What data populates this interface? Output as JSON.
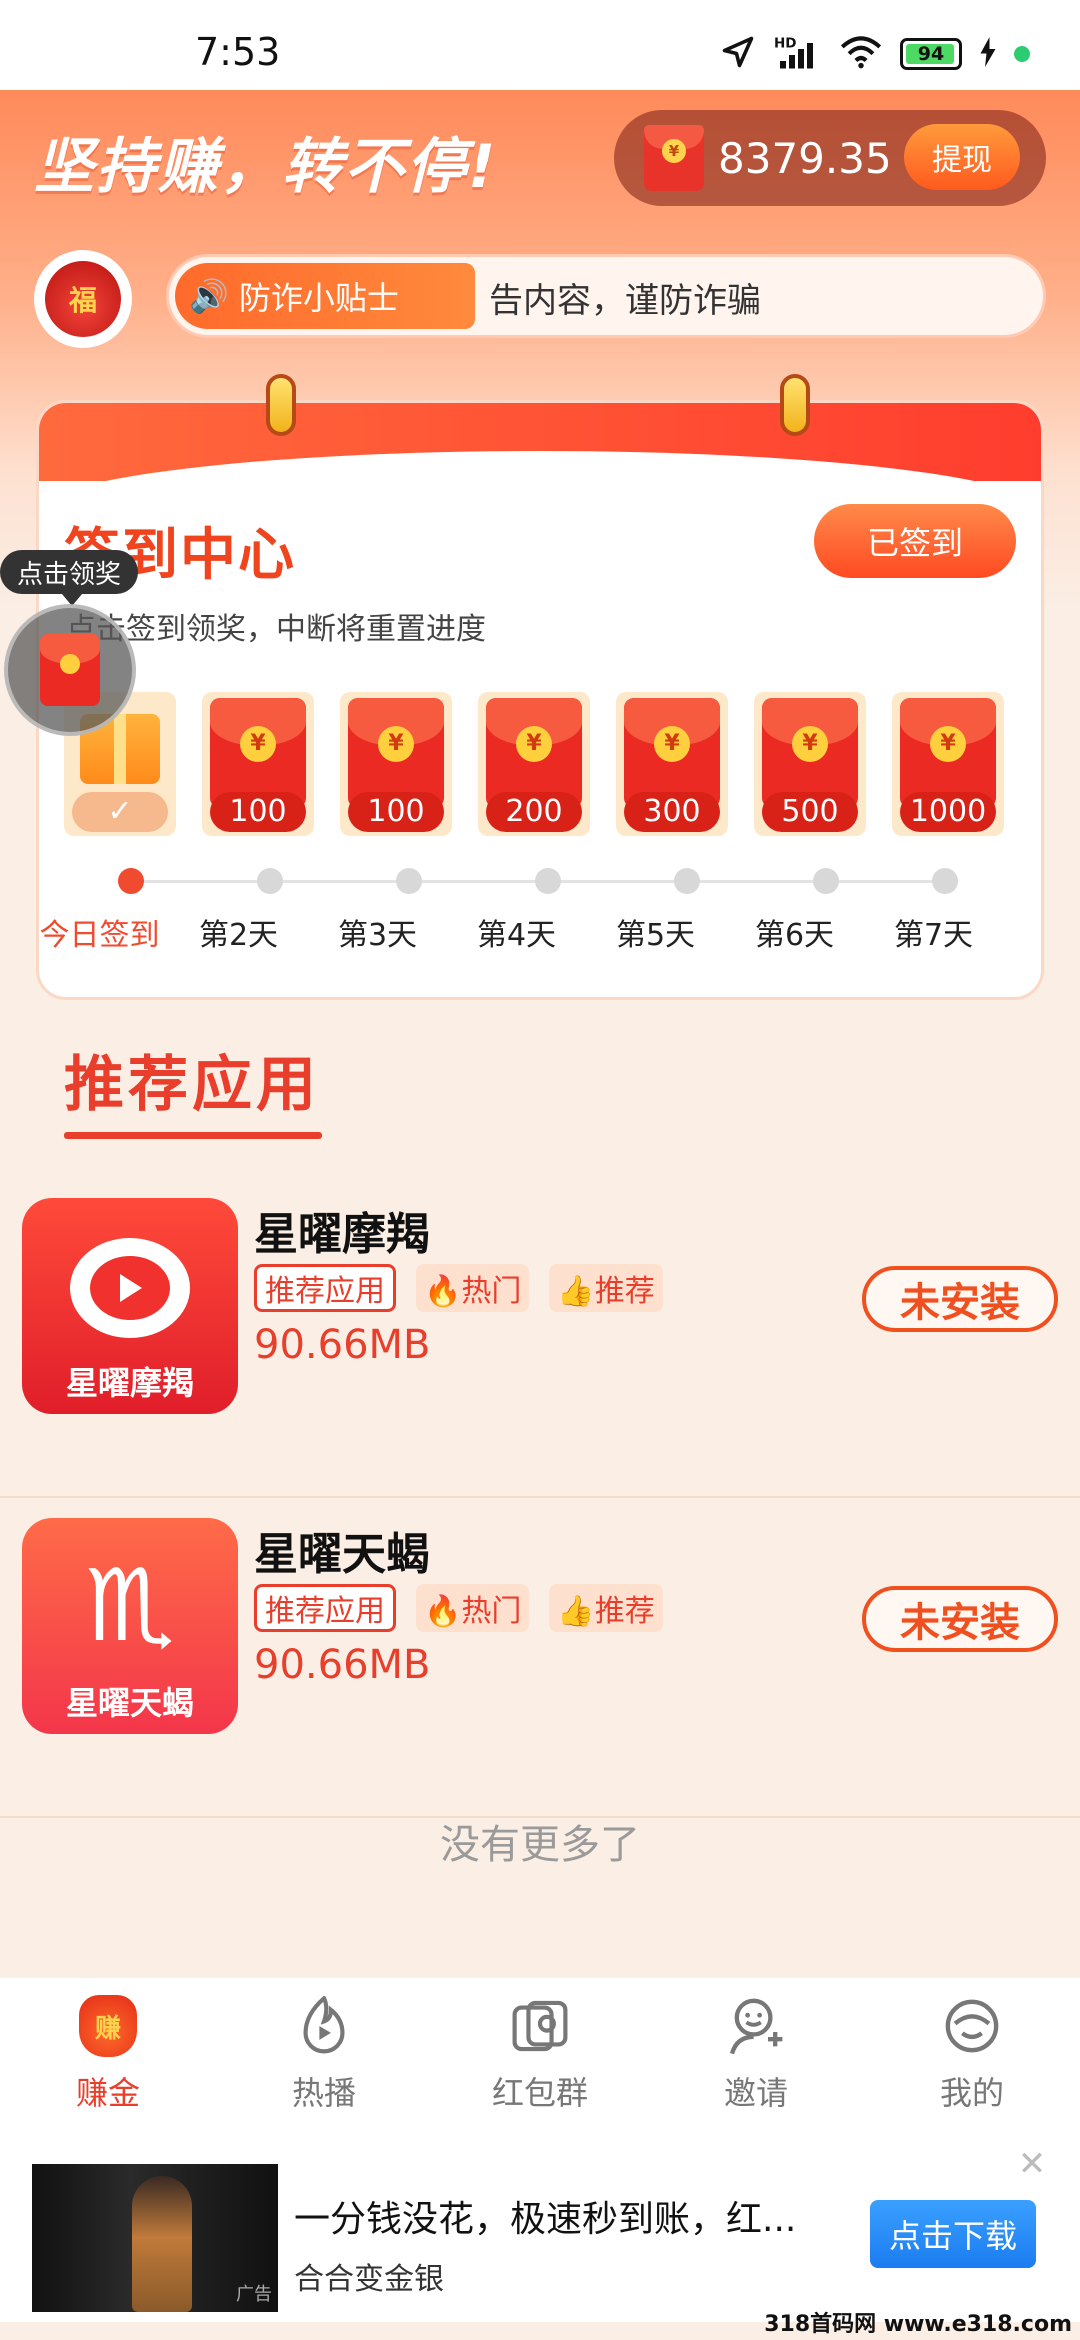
{
  "status_bar": {
    "time": "7:53",
    "network": "HD",
    "battery": "94"
  },
  "header": {
    "slogan": "坚持赚，转不停!",
    "balance": "8379.35",
    "withdraw_label": "提现",
    "fortune_char": "福",
    "notice_tag": "防诈小贴士",
    "notice_text": "告内容，谨防诈骗"
  },
  "signin": {
    "title": "签到中心",
    "signed_label": "已签到",
    "hint": "点击签到领奖，中断将重置进度",
    "rewards": [
      "100",
      "100",
      "200",
      "300",
      "500",
      "1000"
    ],
    "days": [
      "今日签到",
      "第2天",
      "第3天",
      "第4天",
      "第5天",
      "第6天",
      "第7天"
    ],
    "today_check": "✓"
  },
  "floating": {
    "tip": "点击领奖"
  },
  "recommend": {
    "title": "推荐应用",
    "apps": [
      {
        "name": "星曜摩羯",
        "tag_main": "推荐应用",
        "tag_hot": "🔥热门",
        "tag_rec": "👍推荐",
        "size": "90.66MB",
        "button": "未安装",
        "icon_caption": "星曜摩羯"
      },
      {
        "name": "星曜天蝎",
        "tag_main": "推荐应用",
        "tag_hot": "🔥热门",
        "tag_rec": "👍推荐",
        "size": "90.66MB",
        "button": "未安装",
        "icon_caption": "星曜天蝎"
      }
    ],
    "no_more": "没有更多了"
  },
  "bottom_nav": [
    {
      "label": "赚金",
      "icon": "earn-bag-icon",
      "glyph": "赚"
    },
    {
      "label": "热播",
      "icon": "hot-play-icon",
      "glyph": "▶"
    },
    {
      "label": "红包群",
      "icon": "red-packet-group-icon",
      "glyph": "◎"
    },
    {
      "label": "邀请",
      "icon": "invite-icon",
      "glyph": "☺"
    },
    {
      "label": "我的",
      "icon": "profile-icon",
      "glyph": "◡"
    }
  ],
  "ad": {
    "title": "一分钱没花，极速秒到账，红...",
    "subtitle": "合合变金银",
    "button": "点击下载",
    "close": "✕",
    "mark": "广告"
  },
  "watermark": "318首码网 www.e318.com",
  "colors": {
    "accent": "#e93e2b",
    "header": "#ff8a5a",
    "background": "#fbeee4"
  }
}
